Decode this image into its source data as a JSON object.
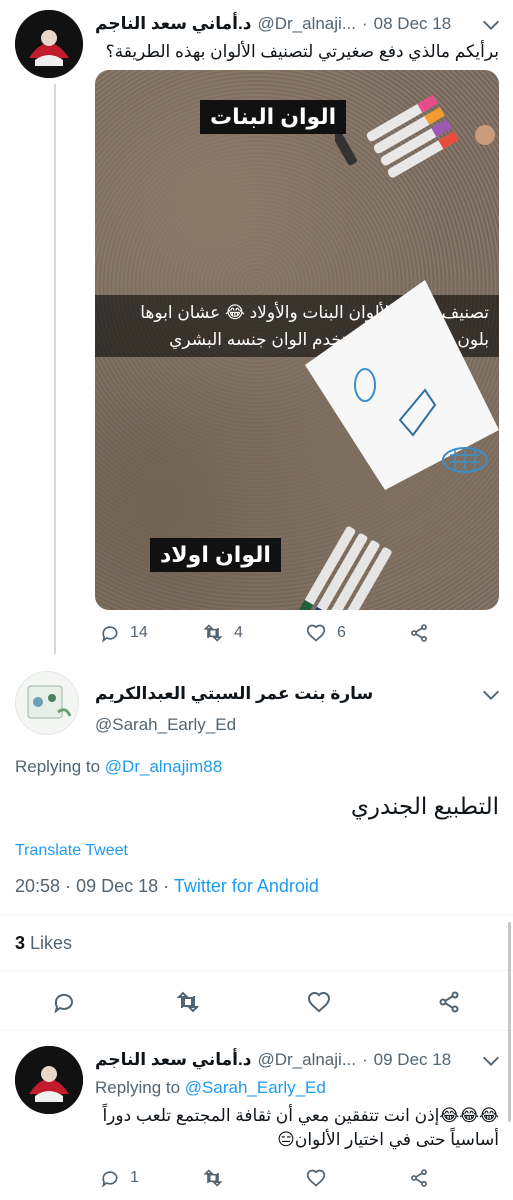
{
  "colors": {
    "link": "#1d9bf0",
    "muted": "#536471",
    "text": "#0f1419",
    "like_red": "#f91880"
  },
  "tweet1": {
    "display_name": "د.أماني  سعد الناجم",
    "handle": "@Dr_alnaji...",
    "dot": "·",
    "date": "08 Dec 18",
    "text": "برأيكم مالذي دفع صغيرتي لتصنيف الألوان بهذه الطريقة؟",
    "media": {
      "label_top": "الوان البنات",
      "caption": "تصنيف ايلاف للألوان البنات والأولاد 😂 عشان ابوها بلون معها. فالكل يستخدم  الوان جنسه البشري",
      "label_bottom": "الوان اولاد"
    },
    "reply_count": "14",
    "retweet_count": "4",
    "like_count": "6"
  },
  "tweet2": {
    "display_name": "سارة بنت عمر السبتي العبدالكريم",
    "handle": "@Sarah_Early_Ed",
    "replying_prefix": "Replying to",
    "replying_handle": "@Dr_alnajim88",
    "text": "التطبيع الجندري",
    "translate": "Translate Tweet",
    "time": "20:58",
    "dot": "·",
    "date": "09 Dec 18",
    "source": "Twitter for Android",
    "likes_number": "3",
    "likes_label": "Likes"
  },
  "tweet3": {
    "display_name": "د.أماني  سعد الناجم",
    "handle": "@Dr_alnaji...",
    "dot": "·",
    "date": "09 Dec 18",
    "replying_prefix": "Replying to",
    "replying_handle": "@Sarah_Early_Ed",
    "text": "😂😂😂إذن انت تتفقين معي أن ثقافة المجتمع تلعب دوراً أساسياً حتى في اختيار الألوان😑",
    "reply_count": "1"
  },
  "icons": [
    "reply-icon",
    "retweet-icon",
    "like-icon",
    "share-icon",
    "chevron-down-icon"
  ]
}
